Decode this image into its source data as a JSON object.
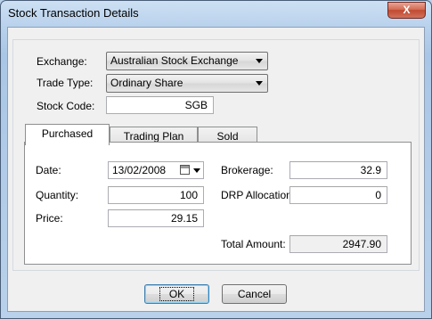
{
  "window": {
    "title": "Stock Transaction Details",
    "close_glyph": "X"
  },
  "form": {
    "exchange_label": "Exchange:",
    "exchange_value": "Australian Stock Exchange",
    "trade_type_label": "Trade Type:",
    "trade_type_value": "Ordinary Share",
    "stock_code_label": "Stock Code:",
    "stock_code_value": "SGB"
  },
  "tabs": [
    {
      "label": "Purchased",
      "active": true
    },
    {
      "label": "Trading Plan",
      "active": false
    },
    {
      "label": "Sold",
      "active": false
    }
  ],
  "purchased": {
    "date_label": "Date:",
    "date_value": "13/02/2008",
    "quantity_label": "Quantity:",
    "quantity_value": "100",
    "price_label": "Price:",
    "price_value": "29.15",
    "brokerage_label": "Brokerage:",
    "brokerage_value": "32.9",
    "drp_label": "DRP Allocation:",
    "drp_value": "0",
    "total_label": "Total Amount:",
    "total_value": "2947.90"
  },
  "buttons": {
    "ok": "OK",
    "cancel": "Cancel"
  }
}
